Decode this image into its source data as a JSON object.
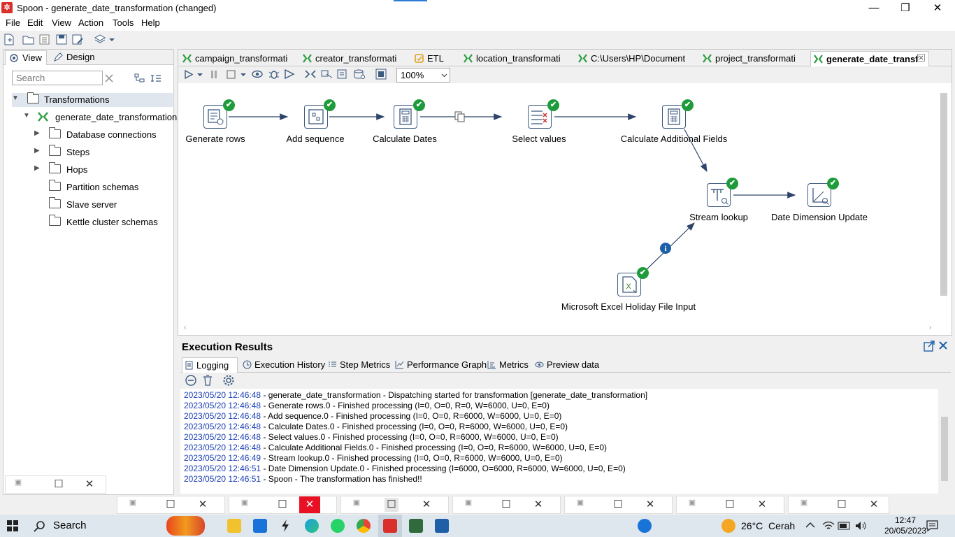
{
  "window": {
    "title": "Spoon - generate_date_transformation (changed)",
    "minimize": "—",
    "maximize": "❐",
    "close": "✕"
  },
  "menu": [
    "File",
    "Edit",
    "View",
    "Action",
    "Tools",
    "Help"
  ],
  "left_panel": {
    "tabs": [
      "View",
      "Design"
    ],
    "search_placeholder": "Search",
    "tree": {
      "root": "Transformations",
      "transformation": "generate_date_transformation",
      "children": [
        "Database connections",
        "Steps",
        "Hops",
        "Partition schemas",
        "Slave server",
        "Kettle cluster schemas"
      ]
    }
  },
  "editor_tabs": [
    "campaign_transformati",
    "creator_transformati",
    "ETL",
    "location_transformati",
    "C:\\Users\\HP\\Document",
    "project_transformati",
    "generate_date_transf"
  ],
  "zoom": "100%",
  "steps": [
    "Generate rows",
    "Add sequence",
    "Calculate Dates",
    "Select values",
    "Calculate Additional Fields",
    "Stream lookup",
    "Date Dimension Update",
    "Microsoft Excel Holiday File Input"
  ],
  "execution": {
    "title": "Execution Results",
    "tabs": [
      "Logging",
      "Execution History",
      "Step Metrics",
      "Performance Graph",
      "Metrics",
      "Preview data"
    ],
    "log": [
      {
        "ts": "2023/05/20 12:46:48",
        "msg": " - generate_date_transformation - Dispatching started for transformation [generate_date_transformation]"
      },
      {
        "ts": "2023/05/20 12:46:48",
        "msg": " - Generate rows.0 - Finished processing (I=0, O=0, R=0, W=6000, U=0, E=0)"
      },
      {
        "ts": "2023/05/20 12:46:48",
        "msg": " - Add sequence.0 - Finished processing (I=0, O=0, R=6000, W=6000, U=0, E=0)"
      },
      {
        "ts": "2023/05/20 12:46:48",
        "msg": " - Calculate Dates.0 - Finished processing (I=0, O=0, R=6000, W=6000, U=0, E=0)"
      },
      {
        "ts": "2023/05/20 12:46:48",
        "msg": " - Select values.0 - Finished processing (I=0, O=0, R=6000, W=6000, U=0, E=0)"
      },
      {
        "ts": "2023/05/20 12:46:48",
        "msg": " - Calculate Additional Fields.0 - Finished processing (I=0, O=0, R=6000, W=6000, U=0, E=0)"
      },
      {
        "ts": "2023/05/20 12:46:49",
        "msg": " - Stream lookup.0 - Finished processing (I=0, O=0, R=6000, W=6000, U=0, E=0)"
      },
      {
        "ts": "2023/05/20 12:46:51",
        "msg": " - Date Dimension Update.0 - Finished processing (I=6000, O=6000, R=6000, W=6000, U=0, E=0)"
      },
      {
        "ts": "2023/05/20 12:46:51",
        "msg": " - Spoon - The transformation has finished!!"
      }
    ]
  },
  "taskbar": {
    "search": "Search",
    "weather": "26°C  Cerah",
    "time": "12:47",
    "date": "20/05/2023"
  },
  "colors": {
    "step_border": "#3d5a80",
    "check_green": "#1e9b3a",
    "log_timestamp": "#1a3eb5",
    "kettle_green": "#2e9c41",
    "app_red": "#d9302c"
  }
}
